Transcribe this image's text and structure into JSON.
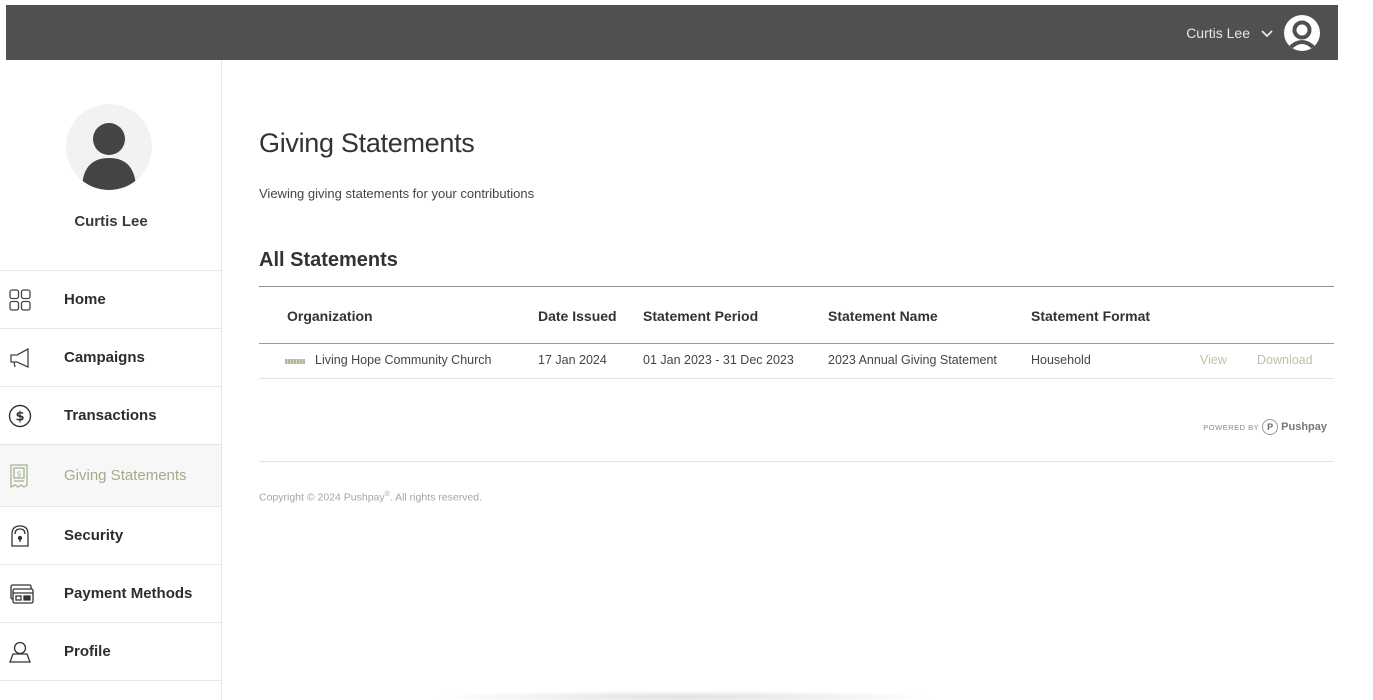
{
  "header": {
    "user_name": "Curtis Lee",
    "icons": {
      "dropdown": "chevron-down-icon",
      "avatar": "user-avatar-icon"
    }
  },
  "sidebar": {
    "profile_name": "Curtis Lee",
    "items": [
      {
        "label": "Home",
        "icon": "grid-icon",
        "active": false
      },
      {
        "label": "Campaigns",
        "icon": "megaphone-icon",
        "active": false
      },
      {
        "label": "Transactions",
        "icon": "dollar-circle-icon",
        "active": false
      },
      {
        "label": "Giving Statements",
        "icon": "receipt-icon",
        "active": true
      },
      {
        "label": "Security",
        "icon": "lock-icon",
        "active": false
      },
      {
        "label": "Payment Methods",
        "icon": "credit-card-icon",
        "active": false
      },
      {
        "label": "Profile",
        "icon": "person-icon",
        "active": false
      }
    ]
  },
  "main": {
    "title": "Giving Statements",
    "subtitle": "Viewing giving statements for your contributions",
    "section_title": "All Statements",
    "table": {
      "columns": [
        "Organization",
        "Date Issued",
        "Statement Period",
        "Statement Name",
        "Statement Format"
      ],
      "rows": [
        {
          "organization": "Living Hope Community Church",
          "date_issued": "17 Jan 2024",
          "statement_period": "01 Jan 2023 - 31 Dec 2023",
          "statement_name": "2023 Annual Giving Statement",
          "statement_format": "Household",
          "view_label": "View",
          "download_label": "Download"
        }
      ]
    }
  },
  "footer": {
    "powered_by": "POWERED BY",
    "badge": "P",
    "brand": "Pushpay",
    "copyright_prefix": "Copyright © 2024 Pushpay",
    "copyright_mark": "®",
    "copyright_suffix": ". All rights reserved."
  },
  "colors": {
    "topbar": "#505050",
    "active_nav": "#9fae86",
    "link": "#b5c7a4"
  }
}
